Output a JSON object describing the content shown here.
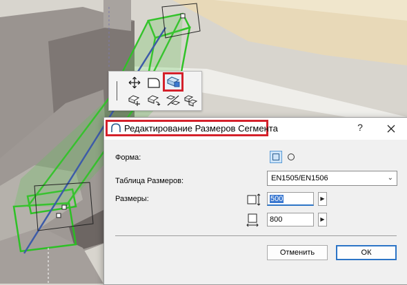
{
  "dialog": {
    "title": "Редактирование Размеров Сегмента",
    "help_label": "?",
    "shape_label": "Форма:",
    "table_label": "Таблица Размеров:",
    "table_value": "EN1505/EN1506",
    "size_label": "Размеры:",
    "width_value": "500",
    "height_value": "800",
    "cancel_label": "Отменить",
    "ok_label": "ОК"
  },
  "colors": {
    "highlight": "#d4202a",
    "selection": "#3b79d1",
    "duct_green": "#27c21f"
  },
  "icons": [
    "move-icon",
    "offset-icon",
    "edit-segment-size-icon",
    "rotate-icon",
    "split-icon",
    "reshape-icon",
    "duplicate-icon",
    "duct-segment-icon",
    "close-icon",
    "dimension-width-icon",
    "dimension-height-icon"
  ]
}
